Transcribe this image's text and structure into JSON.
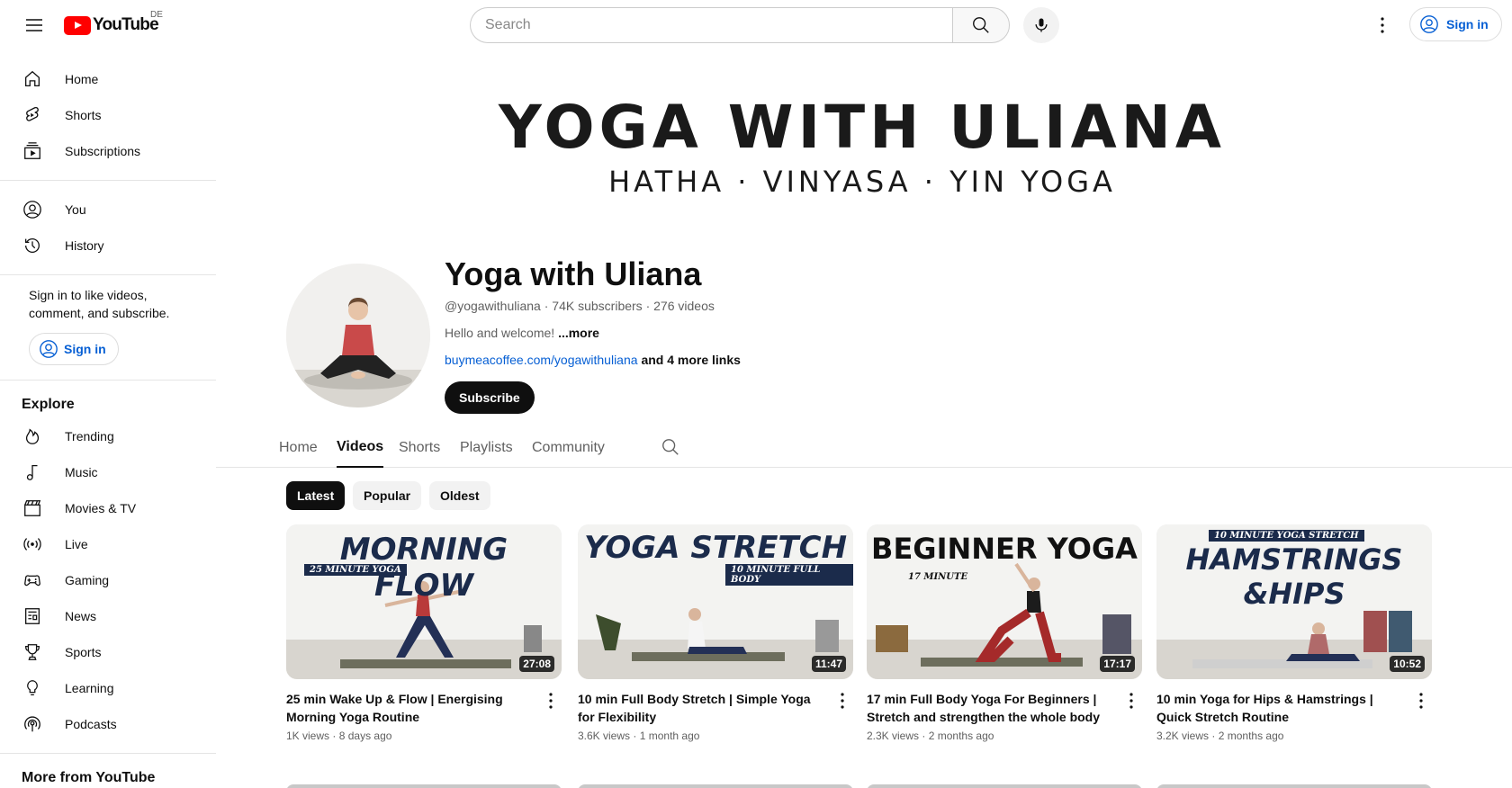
{
  "topbar": {
    "logo_text": "YouTube",
    "country": "DE",
    "search_placeholder": "Search",
    "signin_label": "Sign in"
  },
  "sidebar": {
    "primary": [
      {
        "label": "Home",
        "icon": "home-icon"
      },
      {
        "label": "Shorts",
        "icon": "shorts-icon"
      },
      {
        "label": "Subscriptions",
        "icon": "subscriptions-icon"
      }
    ],
    "secondary": [
      {
        "label": "You",
        "icon": "you-icon"
      },
      {
        "label": "History",
        "icon": "history-icon"
      }
    ],
    "signin_message": "Sign in to like videos, comment, and subscribe.",
    "signin_label": "Sign in",
    "explore_heading": "Explore",
    "explore": [
      {
        "label": "Trending",
        "icon": "trending-icon"
      },
      {
        "label": "Music",
        "icon": "music-icon"
      },
      {
        "label": "Movies & TV",
        "icon": "movies-icon"
      },
      {
        "label": "Live",
        "icon": "live-icon"
      },
      {
        "label": "Gaming",
        "icon": "gaming-icon"
      },
      {
        "label": "News",
        "icon": "news-icon"
      },
      {
        "label": "Sports",
        "icon": "sports-icon"
      },
      {
        "label": "Learning",
        "icon": "learning-icon"
      },
      {
        "label": "Podcasts",
        "icon": "podcasts-icon"
      }
    ],
    "more_heading": "More from YouTube"
  },
  "banner": {
    "title": "YOGA WITH ULIANA",
    "subtitle": "HATHA · VINYASA  · YIN YOGA"
  },
  "channel": {
    "name": "Yoga with Uliana",
    "handle": "@yogawithuliana",
    "subscribers": "74K subscribers",
    "videos": "276 videos",
    "description": "Hello and welcome!",
    "description_more": "...more",
    "link": "buymeacoffee.com/yogawithuliana",
    "more_links": "and 4 more links",
    "subscribe_label": "Subscribe"
  },
  "tabs": [
    "Home",
    "Videos",
    "Shorts",
    "Playlists",
    "Community"
  ],
  "chips": [
    "Latest",
    "Popular",
    "Oldest"
  ],
  "videos": [
    {
      "thumb_text": "MORNING FLOW",
      "thumb_tag": "25 MINUTE YOGA",
      "duration": "27:08",
      "title": "25 min Wake Up & Flow | Energising Morning Yoga Routine",
      "views": "1K views",
      "age": "8 days ago"
    },
    {
      "thumb_text": "YOGA STRETCH",
      "thumb_tag": "10 MINUTE FULL BODY",
      "duration": "11:47",
      "title": "10 min Full Body Stretch | Simple Yoga for Flexibility",
      "views": "3.6K views",
      "age": "1 month ago"
    },
    {
      "thumb_text": "BEGINNER YOGA",
      "thumb_tag": "17 MINUTE",
      "duration": "17:17",
      "title": "17 min Full Body Yoga For Beginners | Stretch and strengthen the whole body",
      "views": "2.3K views",
      "age": "2 months ago"
    },
    {
      "thumb_text": "HAMSTRINGS &HIPS",
      "thumb_tag": "10 MINUTE YOGA STRETCH",
      "duration": "10:52",
      "title": "10 min Yoga for Hips & Hamstrings | Quick Stretch Routine",
      "views": "3.2K views",
      "age": "2 months ago"
    }
  ]
}
